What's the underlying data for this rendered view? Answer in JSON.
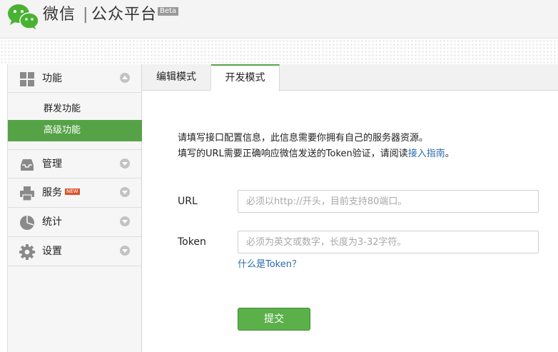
{
  "header": {
    "brand": "微信",
    "separator": "|",
    "subtitle": "公众平台",
    "beta": "Beta"
  },
  "sidebar": {
    "sections": [
      {
        "label": "功能",
        "icon": "grid-icon",
        "expanded": true,
        "items": [
          {
            "label": "群发功能",
            "active": false
          },
          {
            "label": "高级功能",
            "active": true
          }
        ]
      },
      {
        "label": "管理",
        "icon": "inbox-icon",
        "expanded": false
      },
      {
        "label": "服务",
        "icon": "printer-icon",
        "expanded": false,
        "badge": "NEW"
      },
      {
        "label": "统计",
        "icon": "pie-chart-icon",
        "expanded": false
      },
      {
        "label": "设置",
        "icon": "gear-icon",
        "expanded": false
      }
    ]
  },
  "tabs": [
    {
      "label": "编辑模式",
      "active": false
    },
    {
      "label": "开发模式",
      "active": true
    }
  ],
  "main": {
    "desc_line1": "请填写接口配置信息，此信息需要你拥有自己的服务器资源。",
    "desc_line2_prefix": "填写的URL需要正确响应微信发送的Token验证，请阅读",
    "desc_line2_link": "接入指南",
    "desc_line2_suffix": "。",
    "url_label": "URL",
    "url_placeholder": "必须以http://开头，目前支持80端口。",
    "url_value": "",
    "token_label": "Token",
    "token_placeholder": "必须为英文或数字，长度为3-32字符。",
    "token_value": "",
    "token_help": "什么是Token？",
    "submit_label": "提交"
  },
  "colors": {
    "accent_green": "#56a347",
    "link_blue": "#2a6ca8"
  }
}
